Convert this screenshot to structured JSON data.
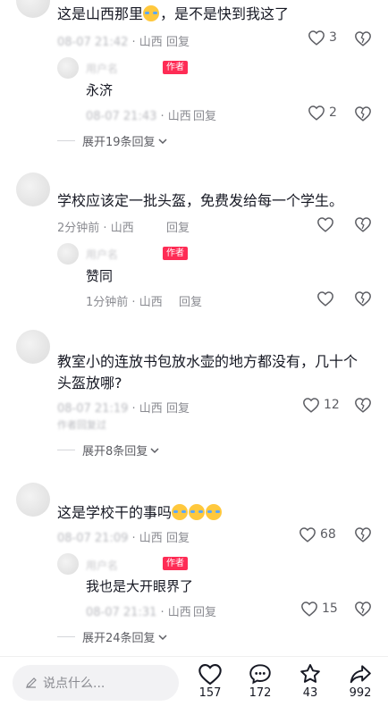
{
  "comments": [
    {
      "text_a": "这是山西那里",
      "text_b": "，是不是快到我这了",
      "time": "08-07 21:42",
      "sep": " · ",
      "location": "山西",
      "reply_label": "回复",
      "likes": "3",
      "sub": {
        "name": "用户名",
        "badge": "作者",
        "text": "永济",
        "time": "08-07 21:43",
        "location": "山西",
        "reply_label": "回复",
        "likes": "2"
      },
      "expand_label": "展开19条回复"
    },
    {
      "text": "学校应该定一批头盔，免费发给每一个学生。",
      "time": "2分钟前",
      "sep": " · ",
      "location": "山西",
      "reply_label": "回复",
      "sub": {
        "name": "用户名",
        "badge": "作者",
        "text": "赞同",
        "time": "1分钟前",
        "location": "山西",
        "reply_label": "回复"
      }
    },
    {
      "text": "教室小的连放书包放水壶的地方都没有，几十个头盔放哪?",
      "time": "08-07 21:19",
      "location": "山西",
      "reply_label": "回复",
      "likes": "12",
      "author_replied": "作者回复过",
      "expand_label": "展开8条回复"
    },
    {
      "text": "这是学校干的事吗",
      "time": "08-07 21:09",
      "location": "山西",
      "reply_label": "回复",
      "likes": "68",
      "sub": {
        "name": "用户名",
        "badge": "作者",
        "text": "我也是大开眼界了",
        "time": "08-07 21:31",
        "location": "山西",
        "reply_label": "回复",
        "likes": "15"
      },
      "expand_label": "展开24条回复"
    }
  ],
  "bottom_bar": {
    "placeholder": "说点什么...",
    "like_count": "157",
    "comment_count": "172",
    "favorite_count": "43",
    "share_count": "992"
  },
  "colors": {
    "accent": "#fe2c55",
    "text": "#161823",
    "meta": "#8a8b91"
  },
  "icons": [
    "heart-icon",
    "dislike-heart-icon",
    "chevron-down-icon",
    "pencil-icon",
    "comment-icon",
    "star-icon",
    "share-icon"
  ]
}
